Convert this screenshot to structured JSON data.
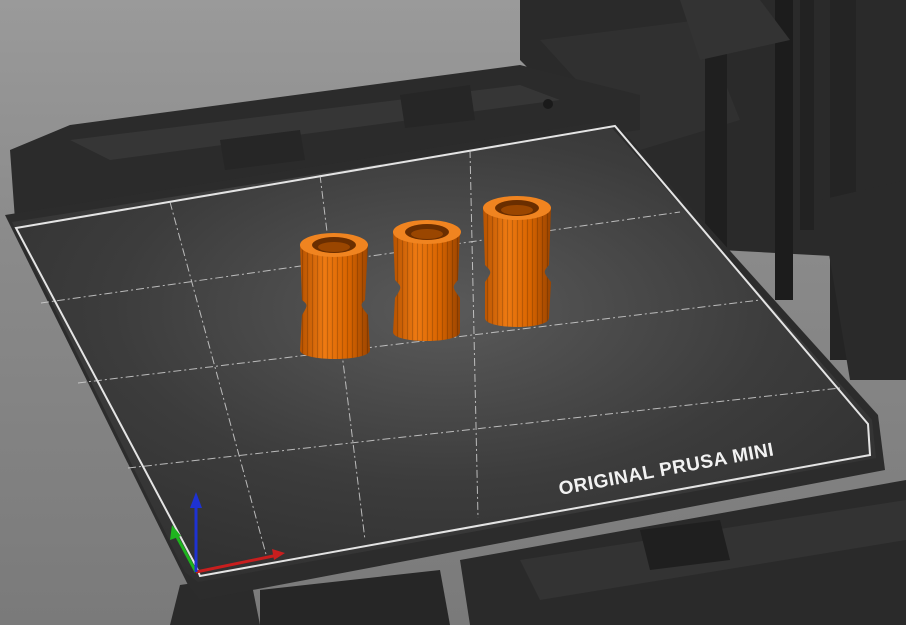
{
  "app": {
    "view": "3D Plater view",
    "printer_name": "ORIGINAL PRUSA MINI"
  },
  "bed": {
    "label": "ORIGINAL PRUSA MINI",
    "surface_color": "#3b3b3b",
    "outline_color": "#e6e6e6",
    "grid_color": "#cfcfcf"
  },
  "objects": [
    {
      "name": "object-1",
      "color": "#e06d0a"
    },
    {
      "name": "object-2",
      "color": "#e06d0a"
    },
    {
      "name": "object-3",
      "color": "#e06d0a"
    }
  ],
  "axes": {
    "x_color": "#c81e1e",
    "y_color": "#1eb41e",
    "z_color": "#1e32d2"
  },
  "colors": {
    "background": "#8e8e8e",
    "frame": "#262626",
    "frame_light": "#333333"
  }
}
